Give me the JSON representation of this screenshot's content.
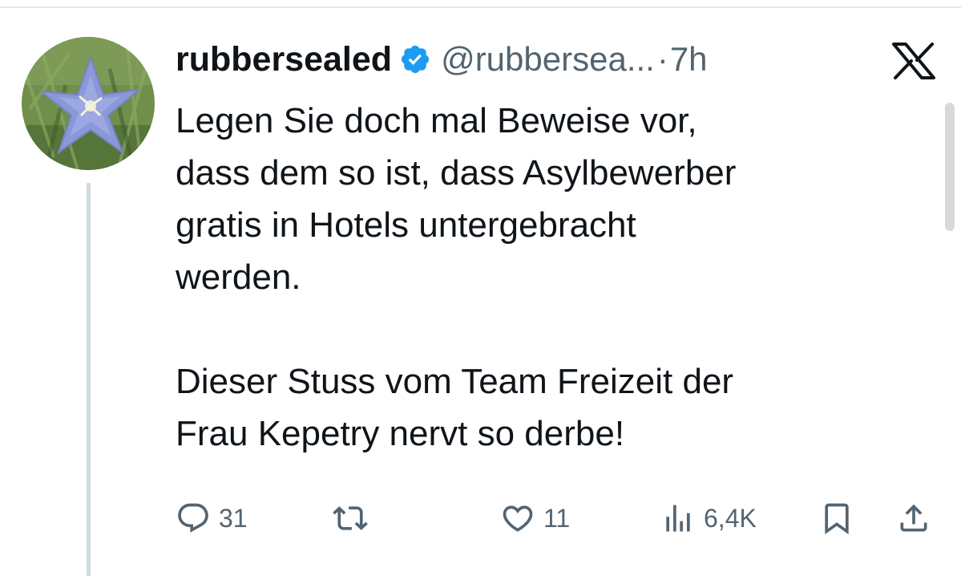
{
  "tweet": {
    "display_name": "rubbersealed",
    "handle": "@rubbersea...",
    "separator": "·",
    "time": "7h",
    "text_lines_1": [
      "Legen Sie doch mal Beweise vor,",
      "dass dem so ist, dass Asylbewerber",
      "gratis in Hotels untergebracht",
      "werden."
    ],
    "text_lines_2": [
      "Dieser Stuss vom Team Freizeit der",
      "Frau Kepetry nervt so derbe!"
    ]
  },
  "actions": {
    "replies": "31",
    "retweets": "",
    "likes": "11",
    "views": "6,4K"
  },
  "icons": {
    "verified": "verified-badge-icon",
    "platform": "x-logo-icon",
    "reply": "reply-icon",
    "retweet": "retweet-icon",
    "like": "heart-icon",
    "views": "views-icon",
    "bookmark": "bookmark-icon",
    "share": "share-icon"
  },
  "colors": {
    "verified": "#1d9bf0",
    "text": "#0f1419",
    "secondary": "#536471",
    "thread_line": "#cfd9de"
  }
}
